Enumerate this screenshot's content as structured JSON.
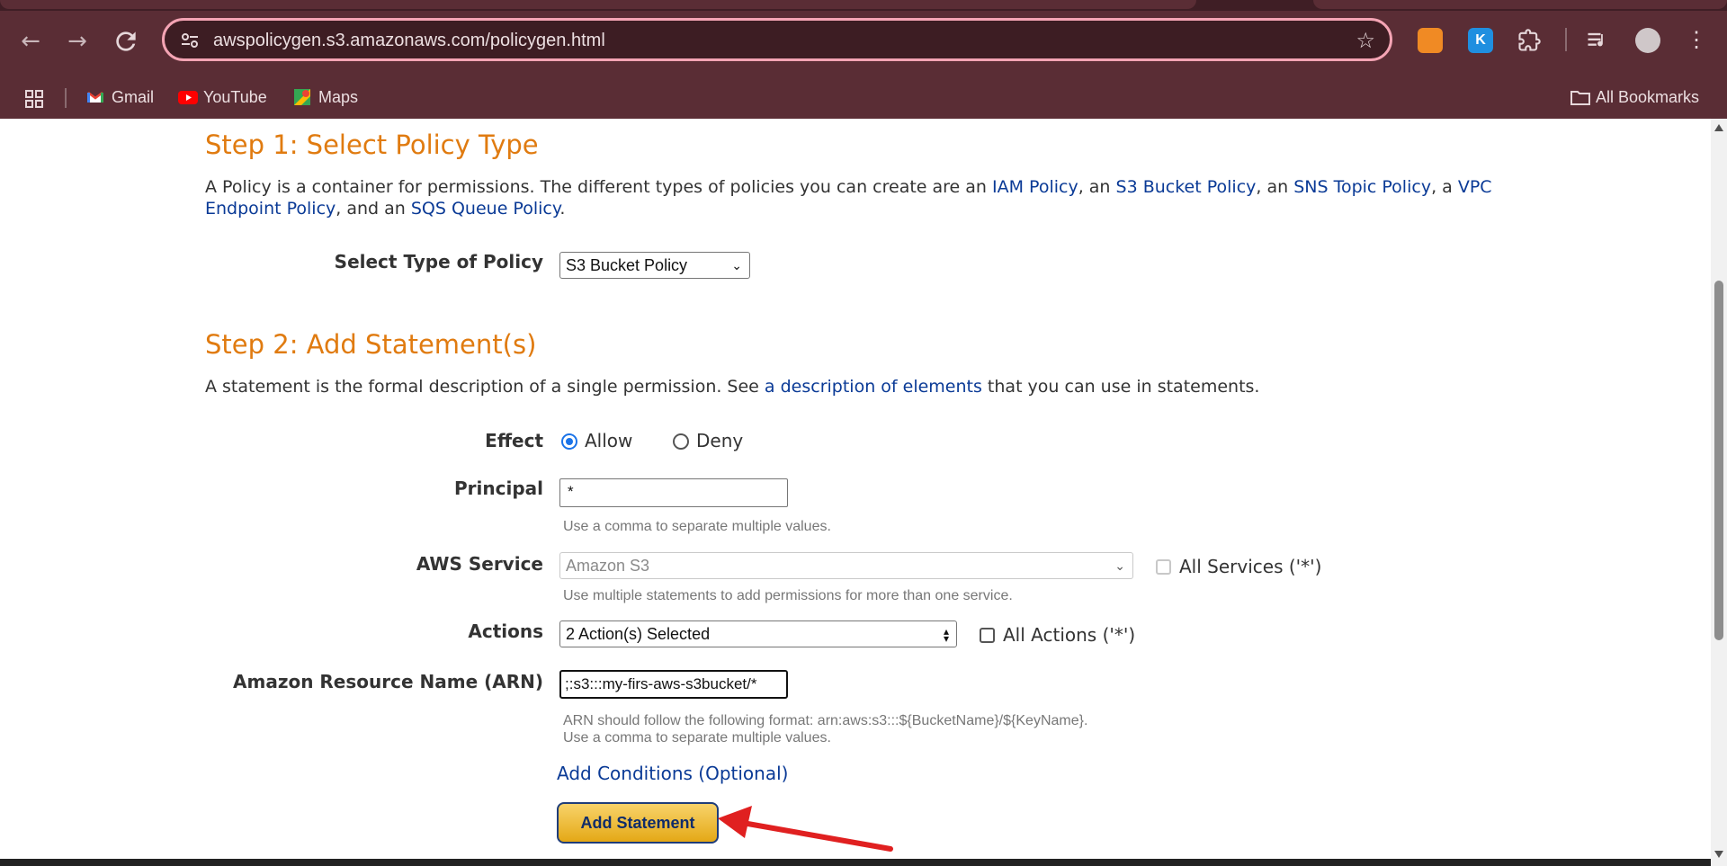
{
  "browser": {
    "url": "awspolicygen.s3.amazonaws.com/policygen.html",
    "bookmarks": [
      "Gmail",
      "YouTube",
      "Maps"
    ],
    "all_bookmarks_label": "All Bookmarks",
    "extension_k_letter": "K"
  },
  "step1": {
    "title": "Step 1: Select Policy Type",
    "desc_parts": [
      "A Policy is a container for permissions. The different types of policies you can create are an ",
      "IAM Policy",
      ", an ",
      "S3 Bucket Policy",
      ", an ",
      "SNS Topic Policy",
      ", a ",
      "VPC Endpoint Policy",
      ", and an ",
      "SQS Queue Policy",
      "."
    ],
    "type_label": "Select Type of Policy",
    "type_value": "S3 Bucket Policy"
  },
  "step2": {
    "title": "Step 2: Add Statement(s)",
    "desc_before": "A statement is the formal description of a single permission. See ",
    "desc_link": "a description of elements",
    "desc_after": " that you can use in statements.",
    "effect_label": "Effect",
    "effect_allow": "Allow",
    "effect_deny": "Deny",
    "principal_label": "Principal",
    "principal_value": "*",
    "principal_hint": "Use a comma to separate multiple values.",
    "service_label": "AWS Service",
    "service_value": "Amazon S3",
    "all_services_label": "All Services ('*')",
    "service_hint": "Use multiple statements to add permissions for more than one service.",
    "actions_label": "Actions",
    "actions_value": "2 Action(s) Selected",
    "all_actions_label": "All Actions ('*')",
    "arn_label": "Amazon Resource Name (ARN)",
    "arn_value": ";:s3:::my-firs-aws-s3bucket/*",
    "arn_hint_1": "ARN should follow the following format: arn:aws:s3:::${BucketName}/${KeyName}.",
    "arn_hint_2": "Use a comma to separate multiple values.",
    "conditions_link": "Add Conditions (Optional)",
    "add_button": "Add Statement"
  },
  "colors": {
    "chrome_bg": "#5a2d35",
    "step_heading": "#e07b10",
    "link": "#0a3a96",
    "button_gradient_top": "#f8d36a",
    "button_gradient_bottom": "#e4a816",
    "annotation_arrow": "#e02020"
  }
}
